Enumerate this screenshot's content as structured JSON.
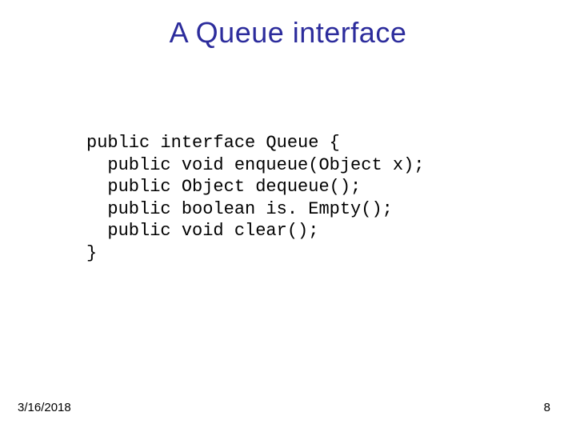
{
  "slide": {
    "title": "A Queue interface"
  },
  "code": {
    "line1": "public interface Queue {",
    "line2": "  public void enqueue(Object x);",
    "line3": "  public Object dequeue();",
    "line4": "  public boolean is. Empty();",
    "line5": "  public void clear();",
    "line6": "}"
  },
  "footer": {
    "date": "3/16/2018",
    "page": "8"
  }
}
